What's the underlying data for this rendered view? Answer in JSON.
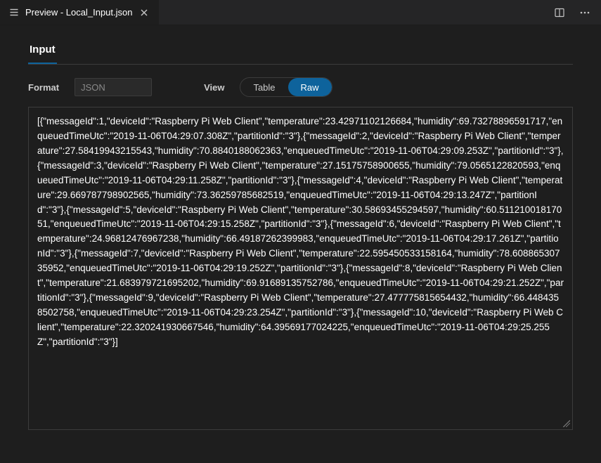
{
  "titlebar": {
    "tab_title": "Preview - Local_Input.json"
  },
  "section": {
    "tab_input": "Input"
  },
  "controls": {
    "format_label": "Format",
    "format_value": "JSON",
    "view_label": "View",
    "view_table": "Table",
    "view_raw": "Raw"
  },
  "raw_text": "[{\"messageId\":1,\"deviceId\":\"Raspberry Pi Web Client\",\"temperature\":23.42971102126684,\"humidity\":69.73278896591717,\"enqueuedTimeUtc\":\"2019-11-06T04:29:07.308Z\",\"partitionId\":\"3\"},{\"messageId\":2,\"deviceId\":\"Raspberry Pi Web Client\",\"temperature\":27.58419943215543,\"humidity\":70.8840188062363,\"enqueuedTimeUtc\":\"2019-11-06T04:29:09.253Z\",\"partitionId\":\"3\"},{\"messageId\":3,\"deviceId\":\"Raspberry Pi Web Client\",\"temperature\":27.15175758900655,\"humidity\":79.0565122820593,\"enqueuedTimeUtc\":\"2019-11-06T04:29:11.258Z\",\"partitionId\":\"3\"},{\"messageId\":4,\"deviceId\":\"Raspberry Pi Web Client\",\"temperature\":29.669787798902565,\"humidity\":73.3625978568251­9,\"enqueuedTimeUtc\":\"2019-11-06T04:29:13.247Z\",\"partitionId\":\"3\"},{\"messageId\":5,\"deviceId\":\"Raspberry Pi Web Client\",\"temperature\":30.58693455294597,\"humidity\":60.51121001817051,\"enqueuedTimeUtc\":\"2019-11-06T04:29:15.258Z\",\"partitionId\":\"3\"},{\"messageId\":6,\"deviceId\":\"Raspberry Pi Web Client\",\"temperature\":24.96812476967238,\"humidity\":66.49187262399983,\"enqueuedTimeUtc\":\"2019-11-06T04:29:17.261Z\",\"partitionId\":\"3\"},{\"messageId\":7,\"deviceId\":\"Raspberry Pi Web Client\",\"temperature\":22.595450533158164,\"humidity\":78.60886530735952,\"enqueuedTimeUtc\":\"2019-11-06T04:29:19.252Z\",\"partitionId\":\"3\"},{\"messageId\":8,\"deviceId\":\"Raspberry Pi Web Client\",\"temperature\":21.683979721695202,\"humidity\":69.91689135752786,\"enqueuedTimeUtc\":\"2019-11-06T04:29:21.252Z\",\"partitionId\":\"3\"},{\"messageId\":9,\"deviceId\":\"Raspberry Pi Web Client\",\"temperature\":27.477775815654432,\"humidity\":66.4484358502758,\"enqueuedTimeUtc\":\"2019-11-06T04:29:23.254Z\",\"partitionId\":\"3\"},{\"messageId\":10,\"deviceId\":\"Raspberry Pi Web Client\",\"temperature\":22.320241930667546,\"humidity\":64.39569177024225,\"enqueuedTimeUtc\":\"2019-11-06T04:29:25.255Z\",\"partitionId\":\"3\"}]"
}
